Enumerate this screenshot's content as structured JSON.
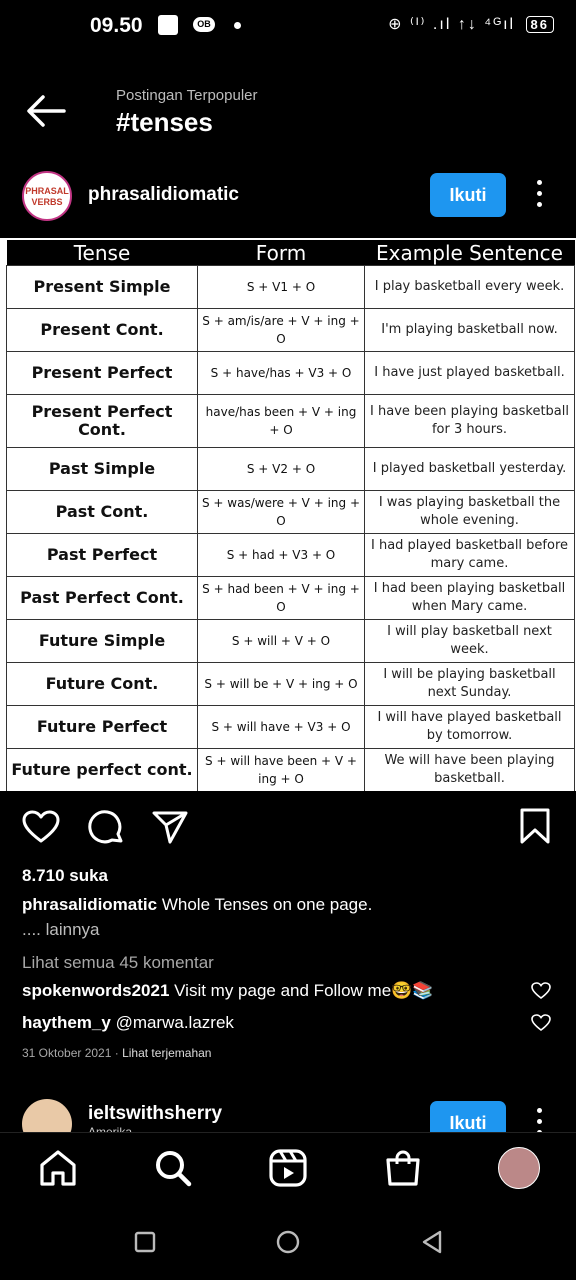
{
  "status": {
    "time": "09.50",
    "ob": "OB",
    "right_icons": "⊕ ⁽ᴵ⁾ .ıl ↑↓ ⁴ᴳıl",
    "battery": "86"
  },
  "header": {
    "subtitle": "Postingan Terpopuler",
    "title": "#tenses"
  },
  "post": {
    "avatar_text": "PHRASAL VERBS",
    "username": "phrasalidiomatic",
    "follow_label": "Ikuti",
    "image": {
      "columns": [
        "Tense",
        "Form",
        "Example Sentence"
      ],
      "rows": [
        [
          "Present Simple",
          "S + V1 + O",
          "I play basketball every week."
        ],
        [
          "Present Cont.",
          "S + am/is/are + V + ing + O",
          "I'm playing basketball now."
        ],
        [
          "Present Perfect",
          "S + have/has + V3 + O",
          "I have just played basketball."
        ],
        [
          "Present Perfect Cont.",
          "have/has been + V + ing + O",
          "I have been playing basketball for 3 hours."
        ],
        [
          "Past Simple",
          "S + V2 + O",
          "I played basketball yesterday."
        ],
        [
          "Past Cont.",
          "S + was/were + V + ing + O",
          "I was playing basketball the whole evening."
        ],
        [
          "Past Perfect",
          "S + had + V3 + O",
          "I had played basketball before mary came."
        ],
        [
          "Past Perfect Cont.",
          "S + had been + V + ing + O",
          "I had been playing basketball when Mary came."
        ],
        [
          "Future Simple",
          "S + will + V + O",
          "I will play basketball next week."
        ],
        [
          "Future Cont.",
          "S + will be + V + ing + O",
          "I will be playing basketball next Sunday."
        ],
        [
          "Future Perfect",
          "S + will have + V3 + O",
          "I will have played basketball by tomorrow."
        ],
        [
          "Future perfect cont.",
          "S + will have been + V + ing + O",
          "We will have been playing basketball."
        ]
      ]
    },
    "likes": "8.710 suka",
    "caption_user": "phrasalidiomatic",
    "caption_text": "Whole Tenses on one page.",
    "more": ".... lainnya",
    "view_comments": "Lihat semua 45 komentar",
    "comments": [
      {
        "user": "spokenwords2021",
        "text": "Visit my page and Follow me🤓📚"
      },
      {
        "user": "haythem_y",
        "text": "@marwa.lazrek"
      }
    ],
    "date": "31 Oktober 2021",
    "translate": "Lihat terjemahan"
  },
  "next_post": {
    "username": "ieltswithsherry",
    "subtitle": "Amerika...",
    "follow_label": "Ikuti"
  },
  "icons": {
    "back": "arrow-left-icon",
    "heart": "heart-icon",
    "comment": "comment-icon",
    "send": "send-icon",
    "bookmark": "bookmark-icon",
    "home": "home-icon",
    "search": "search-icon",
    "reels": "reels-icon",
    "shop": "shop-icon"
  },
  "colors": {
    "follow_button": "#1e96f0",
    "background": "#000000"
  }
}
